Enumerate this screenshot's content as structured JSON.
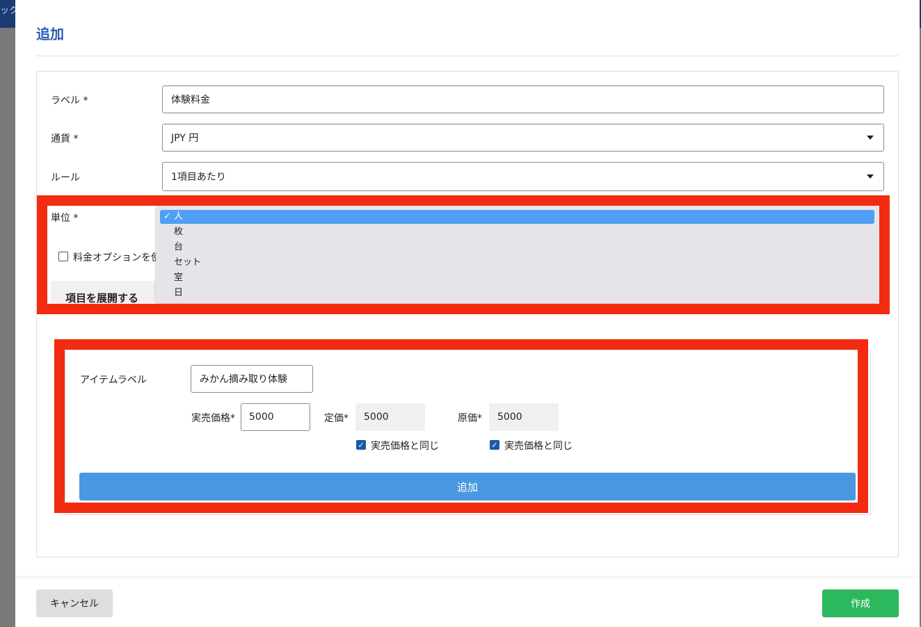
{
  "background": {
    "fragment_text": "ック"
  },
  "modal": {
    "title": "追加",
    "form": {
      "label_field": {
        "label": "ラベル *",
        "value": "体験料金"
      },
      "currency_field": {
        "label": "通貨 *",
        "value": "JPY 円"
      },
      "rule_field": {
        "label": "ルール",
        "value": "1項目あたり"
      },
      "unit_field": {
        "label": "単位 *",
        "options": [
          "人",
          "枚",
          "台",
          "セット",
          "室",
          "日"
        ],
        "selected": "人",
        "check_glyph": "✓"
      },
      "option_checkbox_label": "料金オプションを使",
      "expand_label": "項目を展開する"
    },
    "item": {
      "label": "アイテムラベル",
      "value": "みかん摘み取り体験",
      "actual_price": {
        "label": "実売価格*",
        "value": "5000"
      },
      "list_price": {
        "label": "定価*",
        "value": "5000",
        "same_label": "実売価格と同じ"
      },
      "cost_price": {
        "label": "原価*",
        "value": "5000",
        "same_label": "実売価格と同じ"
      },
      "add_button": "追加"
    },
    "footer": {
      "cancel": "キャンセル",
      "create": "作成"
    }
  },
  "colors": {
    "title": "#2a5db0",
    "highlight_red": "#f32b10",
    "add_button": "#4a98e0",
    "create_button": "#2cb85c",
    "selected_option": "#4f9ff6"
  },
  "icons": [
    "chevron-down-icon",
    "checkmark-icon",
    "checkbox-icon"
  ]
}
